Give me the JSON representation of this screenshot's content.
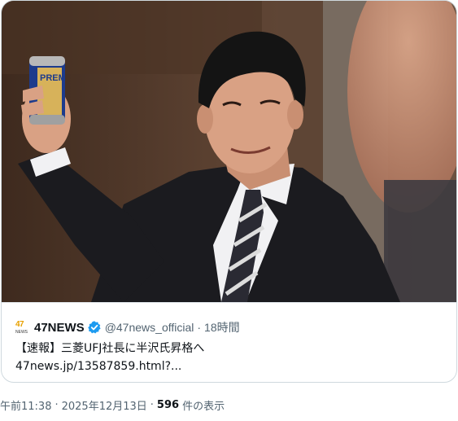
{
  "quote": {
    "logo_number": "47",
    "logo_text": "NEWS",
    "author": "47NEWS",
    "handle": "@47news_official",
    "separator": "·",
    "time": "18時間",
    "line1": "【速報】三菱UFJ社長に半沢氏昇格へ",
    "line2": "47news.jp/13587859.html?..."
  },
  "meta": {
    "time": "午前11:38",
    "separator": "·",
    "date": "2025年12月13日",
    "views_count": "596",
    "views_label": "件の表示"
  },
  "image": {
    "can_label": "PREM",
    "colors": {
      "background": "#4a3526",
      "suit": "#1b1b1f",
      "shirt": "#f1f1f3",
      "skin": "#d9a184",
      "verified": "#1d9bf0",
      "logo": "#e8a100"
    }
  }
}
